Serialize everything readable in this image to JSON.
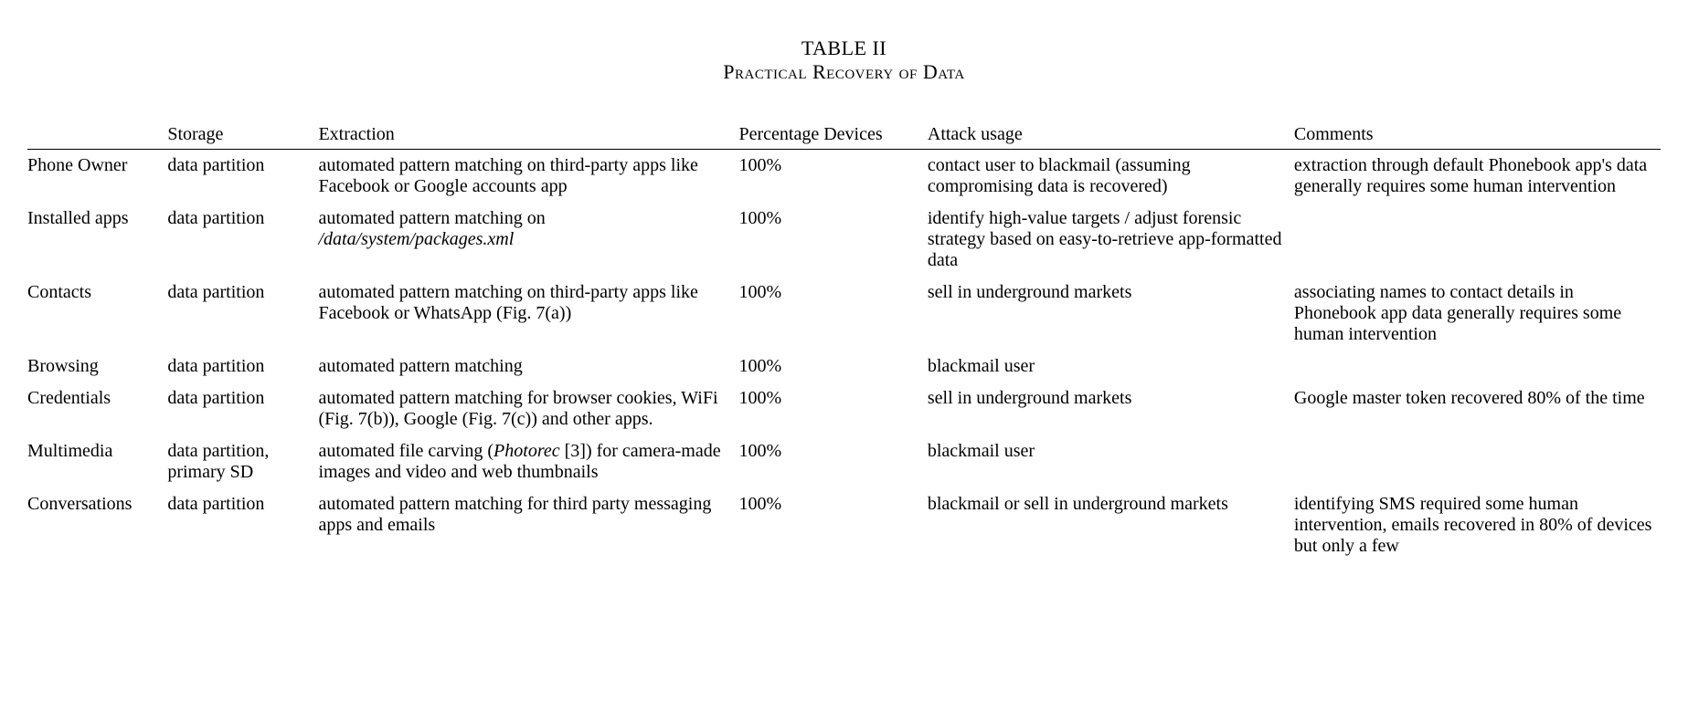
{
  "title": {
    "label": "TABLE II",
    "caption": "Practical Recovery of Data"
  },
  "chart_data": {
    "type": "table",
    "columns": [
      "",
      "Storage",
      "Extraction",
      "Percentage Devices",
      "Attack usage",
      "Comments"
    ],
    "rows": [
      {
        "name": "Phone Owner",
        "storage": "data partition",
        "extraction": "automated pattern matching on third-party apps like Facebook or Google accounts app",
        "percentage": "100%",
        "attack": "contact user to blackmail (assuming compromising data is recovered)",
        "comments": "extraction through default Phonebook app's data generally requires some human intervention"
      },
      {
        "name": "Installed apps",
        "storage": "data partition",
        "extraction_pre": "automated pattern matching on ",
        "extraction_italic": "/data/system/packages.xml",
        "percentage": "100%",
        "attack": "identify high-value targets / adjust forensic strategy based on easy-to-retrieve app-formatted data",
        "comments": ""
      },
      {
        "name": "Contacts",
        "storage": "data partition",
        "extraction": "automated pattern matching on third-party apps like Facebook or WhatsApp (Fig. 7(a))",
        "percentage": "100%",
        "attack": "sell in underground markets",
        "comments": "associating names to contact details in Phonebook app data generally requires some human intervention"
      },
      {
        "name": "Browsing",
        "storage": "data partition",
        "extraction": "automated pattern matching",
        "percentage": "100%",
        "attack": "blackmail user",
        "comments": ""
      },
      {
        "name": "Credentials",
        "storage": "data partition",
        "extraction": "automated pattern matching for browser cookies, WiFi (Fig. 7(b)), Google (Fig. 7(c)) and other apps.",
        "percentage": "100%",
        "attack": "sell in underground markets",
        "comments": "Google master token recovered 80% of the time"
      },
      {
        "name": "Multimedia",
        "storage": "data partition, primary SD",
        "extraction_pre": "automated file carving (",
        "extraction_italic": "Photorec",
        "extraction_post": " [3]) for camera-made images and video and web thumbnails",
        "percentage": "100%",
        "attack": "blackmail user",
        "comments": ""
      },
      {
        "name": "Conversations",
        "storage": "data partition",
        "extraction": "automated pattern matching for third party messaging apps and emails",
        "percentage": "100%",
        "attack": "blackmail or sell in underground markets",
        "comments": "identifying SMS required some human intervention, emails recovered in 80% of devices but only a few"
      }
    ]
  }
}
